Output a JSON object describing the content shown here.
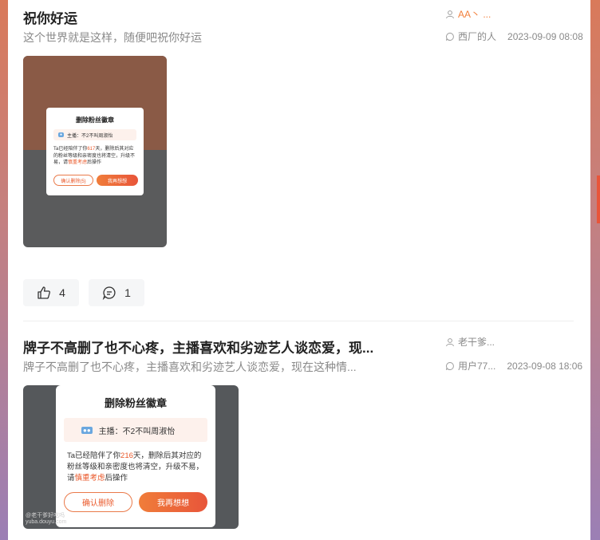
{
  "colors": {
    "accent": "#f2803d",
    "muted": "#8a8a8a",
    "title": "#222222"
  },
  "posts": [
    {
      "title": "祝你好运",
      "summary": "这个世界就是这样，随便吧祝你好运",
      "author": "AA丶 ...",
      "replier": "西厂的人",
      "time": "2023-09-09 08:08",
      "likes": "4",
      "comments": "1",
      "thumb": {
        "dialog_title": "删除粉丝徽章",
        "anchor": "主播：不2不叫周淑怡",
        "body_a": "Ta已经陪伴了你",
        "days": "617",
        "body_b": "天，删除后其对应的粉丝等级和亲密度也将清空，升级不易，请",
        "careful": "慎重考虑",
        "body_c": "后操作",
        "confirm": "确认删除(5)",
        "reconsider": "我再想想"
      }
    },
    {
      "title": "牌子不高删了也不心疼，主播喜欢和劣迹艺人谈恋爱，现...",
      "summary": "牌子不高删了也不心疼，主播喜欢和劣迹艺人谈恋爱，现在这种情...",
      "author": "老干爹...",
      "replier": "用户77...",
      "time": "2023-09-08 18:06",
      "thumb": {
        "dialog_title": "删除粉丝徽章",
        "anchor": "主播：不2不叫周淑怡",
        "body_a": "Ta已经陪伴了你",
        "days": "216",
        "body_b": "天，删除后其对应的粉丝等级和亲密度也将清空，升级不易，请",
        "careful": "慎重考虑",
        "body_c": "后操作",
        "confirm": "确认删除",
        "reconsider": "我再想想",
        "watermark_1": "@老干爹好吃吗",
        "watermark_2": "yuba.douyu.com"
      }
    }
  ]
}
